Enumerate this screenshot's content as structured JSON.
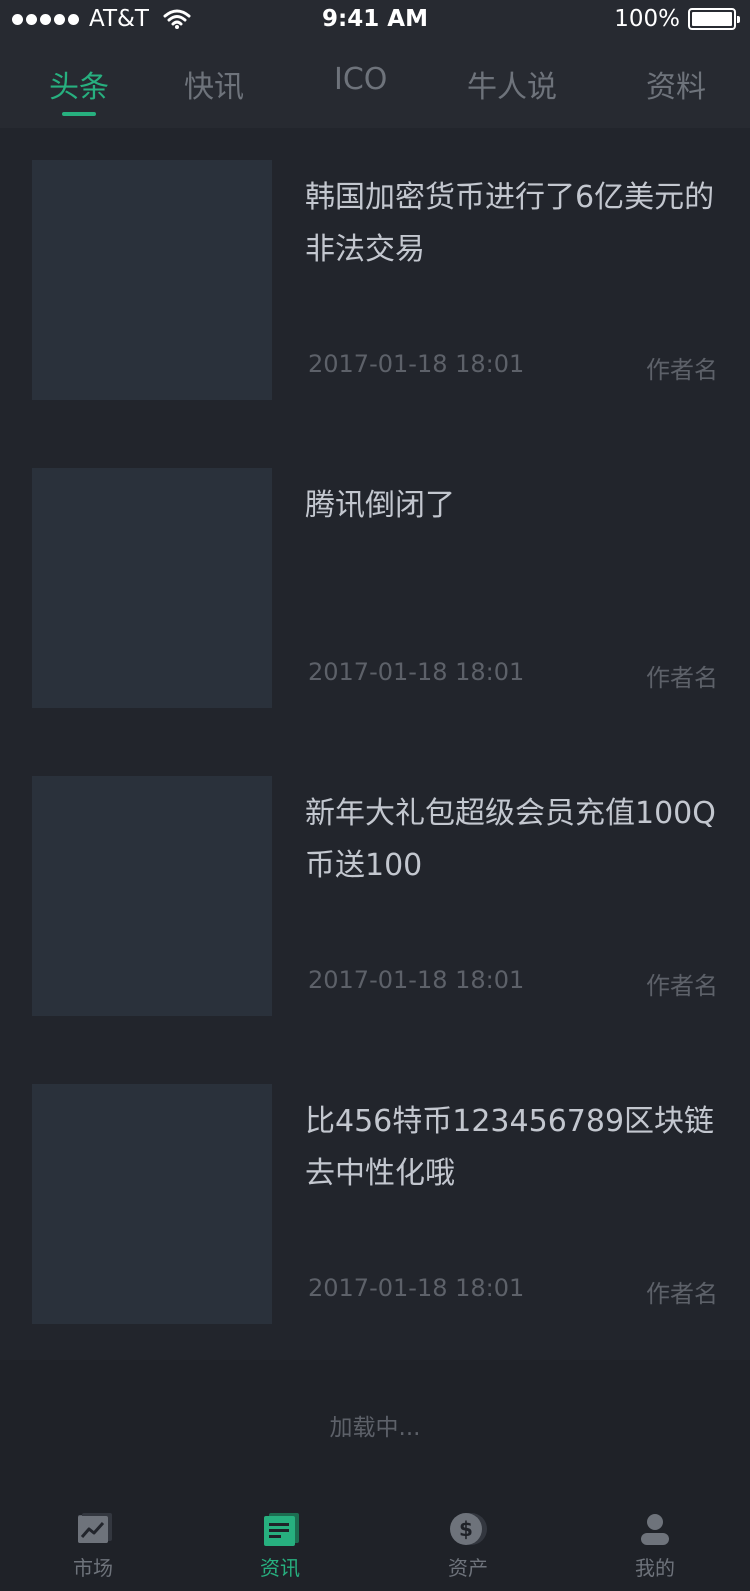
{
  "status_bar": {
    "carrier": "AT&T",
    "time": "9:41 AM",
    "battery": "100%"
  },
  "tabs": [
    {
      "label": "头条",
      "active": true
    },
    {
      "label": "快讯",
      "active": false
    },
    {
      "label": "ICO",
      "active": false
    },
    {
      "label": "牛人说",
      "active": false
    },
    {
      "label": "资料",
      "active": false
    }
  ],
  "news": [
    {
      "title": "韩国加密货币进行了6亿美元的非法交易",
      "date": "2017-01-18 18:01",
      "author": "作者名"
    },
    {
      "title": "腾讯倒闭了",
      "date": "2017-01-18 18:01",
      "author": "作者名"
    },
    {
      "title": "新年大礼包超级会员充值100Q币送100",
      "date": "2017-01-18 18:01",
      "author": "作者名"
    },
    {
      "title": "比456特币123456789区块链去中性化哦",
      "date": "2017-01-18 18:01",
      "author": "作者名"
    }
  ],
  "loading_text": "加载中...",
  "bottom_nav": [
    {
      "label": "市场",
      "icon": "chart-icon",
      "active": false
    },
    {
      "label": "资讯",
      "icon": "news-icon",
      "active": true
    },
    {
      "label": "资产",
      "icon": "dollar-coin-icon",
      "active": false
    },
    {
      "label": "我的",
      "icon": "user-icon",
      "active": false
    }
  ],
  "colors": {
    "accent": "#27b07f",
    "background": "#22252c",
    "inactive": "#6e737b"
  }
}
